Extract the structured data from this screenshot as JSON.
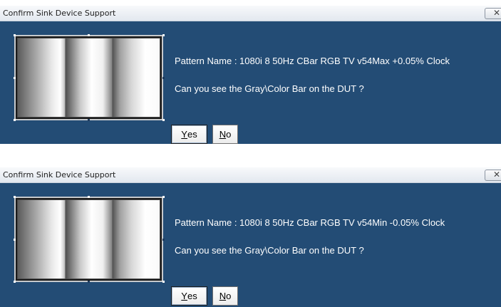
{
  "dialogs": [
    {
      "title": "Confirm Sink Device Support",
      "close_glyph": "✕",
      "pattern_label": "Pattern Name : ",
      "pattern_name": "1080i 8 50Hz CBar RGB TV v54Max +0.05% Clock",
      "question": "Can you see the Gray\\Color Bar on the DUT ?",
      "yes_first": "Y",
      "yes_rest": "es",
      "no_first": "N",
      "no_rest": "o"
    },
    {
      "title": "Confirm Sink Device Support",
      "close_glyph": "✕",
      "pattern_label": "Pattern Name : ",
      "pattern_name": "1080i 8 50Hz CBar RGB TV v54Min -0.05% Clock",
      "question": "Can you see the Gray\\Color Bar on the DUT ?",
      "yes_first": "Y",
      "yes_rest": "es",
      "no_first": "N",
      "no_rest": "o"
    }
  ],
  "colors": {
    "panel_background": "#234c75",
    "titlebar_background": "#e8ecf2",
    "text_on_panel": "#ffffff"
  },
  "icons": {
    "close": "close-icon",
    "preview": "gray-color-bar-pattern"
  }
}
